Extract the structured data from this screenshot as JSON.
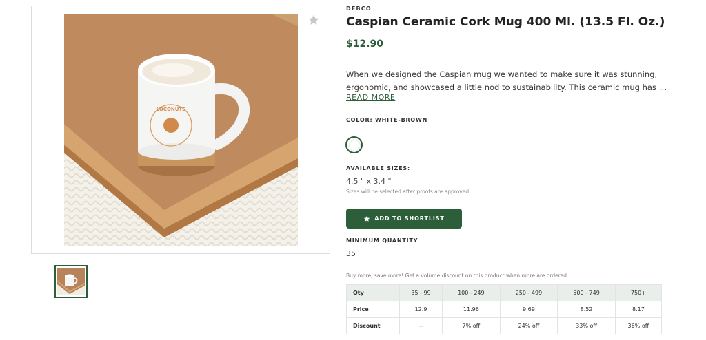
{
  "product": {
    "brand": "DEBCO",
    "title": "Caspian Ceramic Cork Mug 400 Ml. (13.5 Fl. Oz.)",
    "price": "$12.90",
    "description_line1": "When we designed the Caspian mug we wanted to make sure it was stunning,",
    "description_line2": "ergonomic, and showcased a little nod to sustainability. This ceramic mug has a...",
    "read_more": "READ MORE",
    "mug_logo_text": "LOCONUTS"
  },
  "color": {
    "label": "COLOR: WHITE-BROWN",
    "swatch": "#ffffff"
  },
  "sizes": {
    "label": "AVAILABLE SIZES:",
    "value": "4.5 \" x 3.4 \"",
    "note": "Sizes will be selected after proofs are approved"
  },
  "shortlist": {
    "label": "ADD TO SHORTLIST"
  },
  "minimum": {
    "label": "MINIMUM QUANTITY",
    "value": "35"
  },
  "discount_note": "Buy more, save more! Get a volume discount on this product when more are ordered.",
  "pricing_table": {
    "rows": [
      [
        "Qty",
        "35 - 99",
        "100 - 249",
        "250 - 499",
        "500 - 749",
        "750+"
      ],
      [
        "Price",
        "12.9",
        "11.96",
        "9.69",
        "8.52",
        "8.17"
      ],
      [
        "Discount",
        "--",
        "7% off",
        "24% off",
        "33% off",
        "36% off"
      ]
    ]
  },
  "colors": {
    "accent": "#2d5e3a"
  }
}
